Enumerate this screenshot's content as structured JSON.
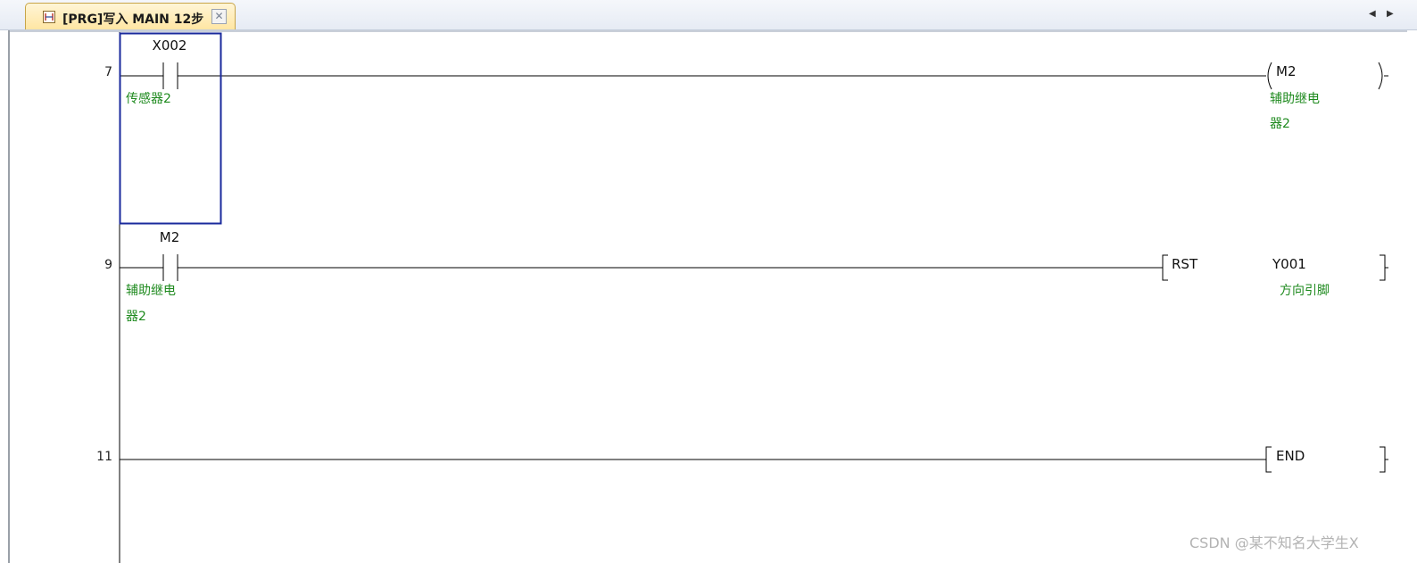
{
  "tab": {
    "title": "[PRG]写入 MAIN 12步",
    "close_glyph": "✕",
    "icon": "ladder-program-icon"
  },
  "nav": {
    "left": "◀",
    "right": "▶"
  },
  "ladder": {
    "rungs": [
      {
        "step": "7",
        "contact": {
          "device": "X002",
          "comment": "传感器2"
        },
        "coil": {
          "device": "M2",
          "comment_lines": [
            "辅助继电",
            "器2"
          ]
        }
      },
      {
        "step": "9",
        "contact": {
          "device": "M2",
          "comment_lines": [
            "辅助继电",
            "器2"
          ]
        },
        "instruction": {
          "name": "RST",
          "operand": "Y001",
          "comment": "方向引脚"
        }
      },
      {
        "step": "11",
        "instruction": {
          "name": "END"
        }
      }
    ]
  },
  "watermark": "CSDN @某不知名大学生X",
  "colors": {
    "cursor": "#1a2a9c",
    "comment": "#1e8a1e",
    "tab_active": "#ffe6a3"
  }
}
